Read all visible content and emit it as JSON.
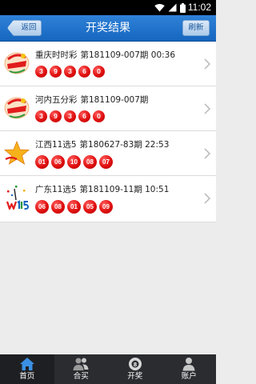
{
  "status_bar": {
    "time": "11:02"
  },
  "nav": {
    "back_label": "返回",
    "title": "开奖结果",
    "refresh_label": "刷新"
  },
  "results": [
    {
      "logo": "ssc-logo",
      "name": "重庆时时彩",
      "issue": "第181109-007期",
      "time": "00:36",
      "balls": [
        "3",
        "9",
        "3",
        "6",
        "0"
      ]
    },
    {
      "logo": "ssc-logo",
      "name": "河内五分彩",
      "issue": "第181109-007期",
      "time": "",
      "balls": [
        "3",
        "9",
        "3",
        "6",
        "0"
      ]
    },
    {
      "logo": "star-logo",
      "name": "江西11选5",
      "issue": "第180627-83期",
      "time": "22:53",
      "balls": [
        "01",
        "06",
        "10",
        "08",
        "07"
      ]
    },
    {
      "logo": "gd115-logo",
      "name": "广东11选5",
      "issue": "第181109-11期",
      "time": "10:51",
      "balls": [
        "06",
        "08",
        "01",
        "05",
        "09"
      ]
    }
  ],
  "tabs": [
    {
      "label": "首页",
      "icon": "home-icon",
      "active": true
    },
    {
      "label": "合买",
      "icon": "group-buy-icon",
      "active": false
    },
    {
      "label": "开奖",
      "icon": "lottery-ball-icon",
      "active": false
    },
    {
      "label": "账户",
      "icon": "account-icon",
      "active": false
    }
  ]
}
